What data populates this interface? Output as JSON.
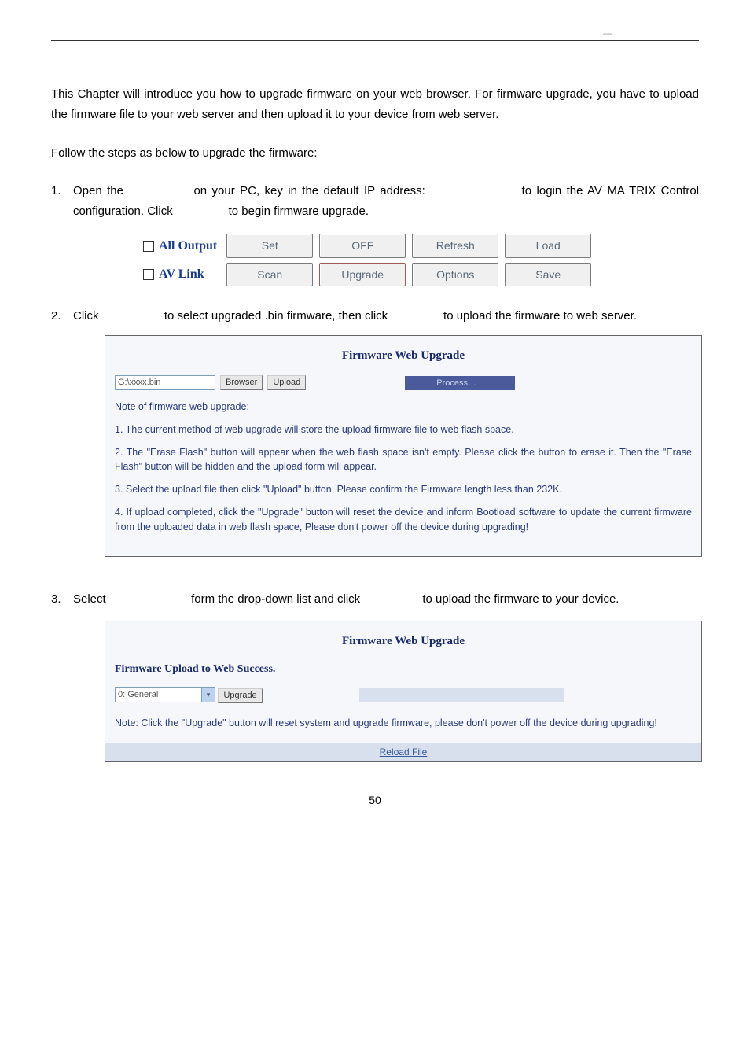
{
  "top_dash": "—",
  "intro": "This Chapter will introduce you how to upgrade firmware on your web browser. For firmware upgrade, you have to upload the firmware file to your web server and then upload it to your device from web server.",
  "follow": "Follow the steps as below to upgrade the firmware:",
  "step1_a": "Open the",
  "step1_b": "on your PC, key in the default IP address:",
  "step1_c": "to",
  "step1_d": "login the AV MA TRIX Control configuration. Click",
  "step1_e": "to begin firmware upgrade.",
  "panel1": {
    "row1_label": "All Output",
    "row1_btns": [
      "Set",
      "OFF",
      "Refresh",
      "Load"
    ],
    "row2_label": "AV Link",
    "row2_btns": [
      "Scan",
      "Upgrade",
      "Options",
      "Save"
    ]
  },
  "step2_a": "Click",
  "step2_b": "to select upgraded .bin firmware, then click",
  "step2_c": "to upload the firmware to web server.",
  "fw1": {
    "title": "Firmware Web Upgrade",
    "file": "G:\\xxxx.bin",
    "browser": "Browser",
    "upload": "Upload",
    "process": "Process…",
    "note_hdr": "Note of firmware web upgrade:",
    "n1": "1. The current method of web upgrade will store the upload firmware file to web flash space.",
    "n2": "2. The \"Erase Flash\" button will appear when the web flash space isn't empty. Please click the button to erase it. Then the \"Erase Flash\" button will be hidden and the upload form will appear.",
    "n3": "3. Select the upload file then click \"Upload\" button, Please confirm the Firmware length less than 232K.",
    "n4": "4. If upload completed, click the \"Upgrade\" button will reset the device and inform Bootload software to update the current firmware from the uploaded data in web flash space, Please don't power off the device during upgrading!"
  },
  "step3_a": "Select",
  "step3_b": "form the drop-down list and click",
  "step3_c": "to upload the firmware to your device.",
  "fw2": {
    "title": "Firmware Web Upgrade",
    "success": "Firmware Upload to Web Success.",
    "select_val": "0: General",
    "upgrade": "Upgrade",
    "note": "Note: Click the \"Upgrade\" button will reset system and upgrade firmware, please don't power off the device during upgrading!",
    "reload": "Reload File"
  },
  "pagenum": "50"
}
